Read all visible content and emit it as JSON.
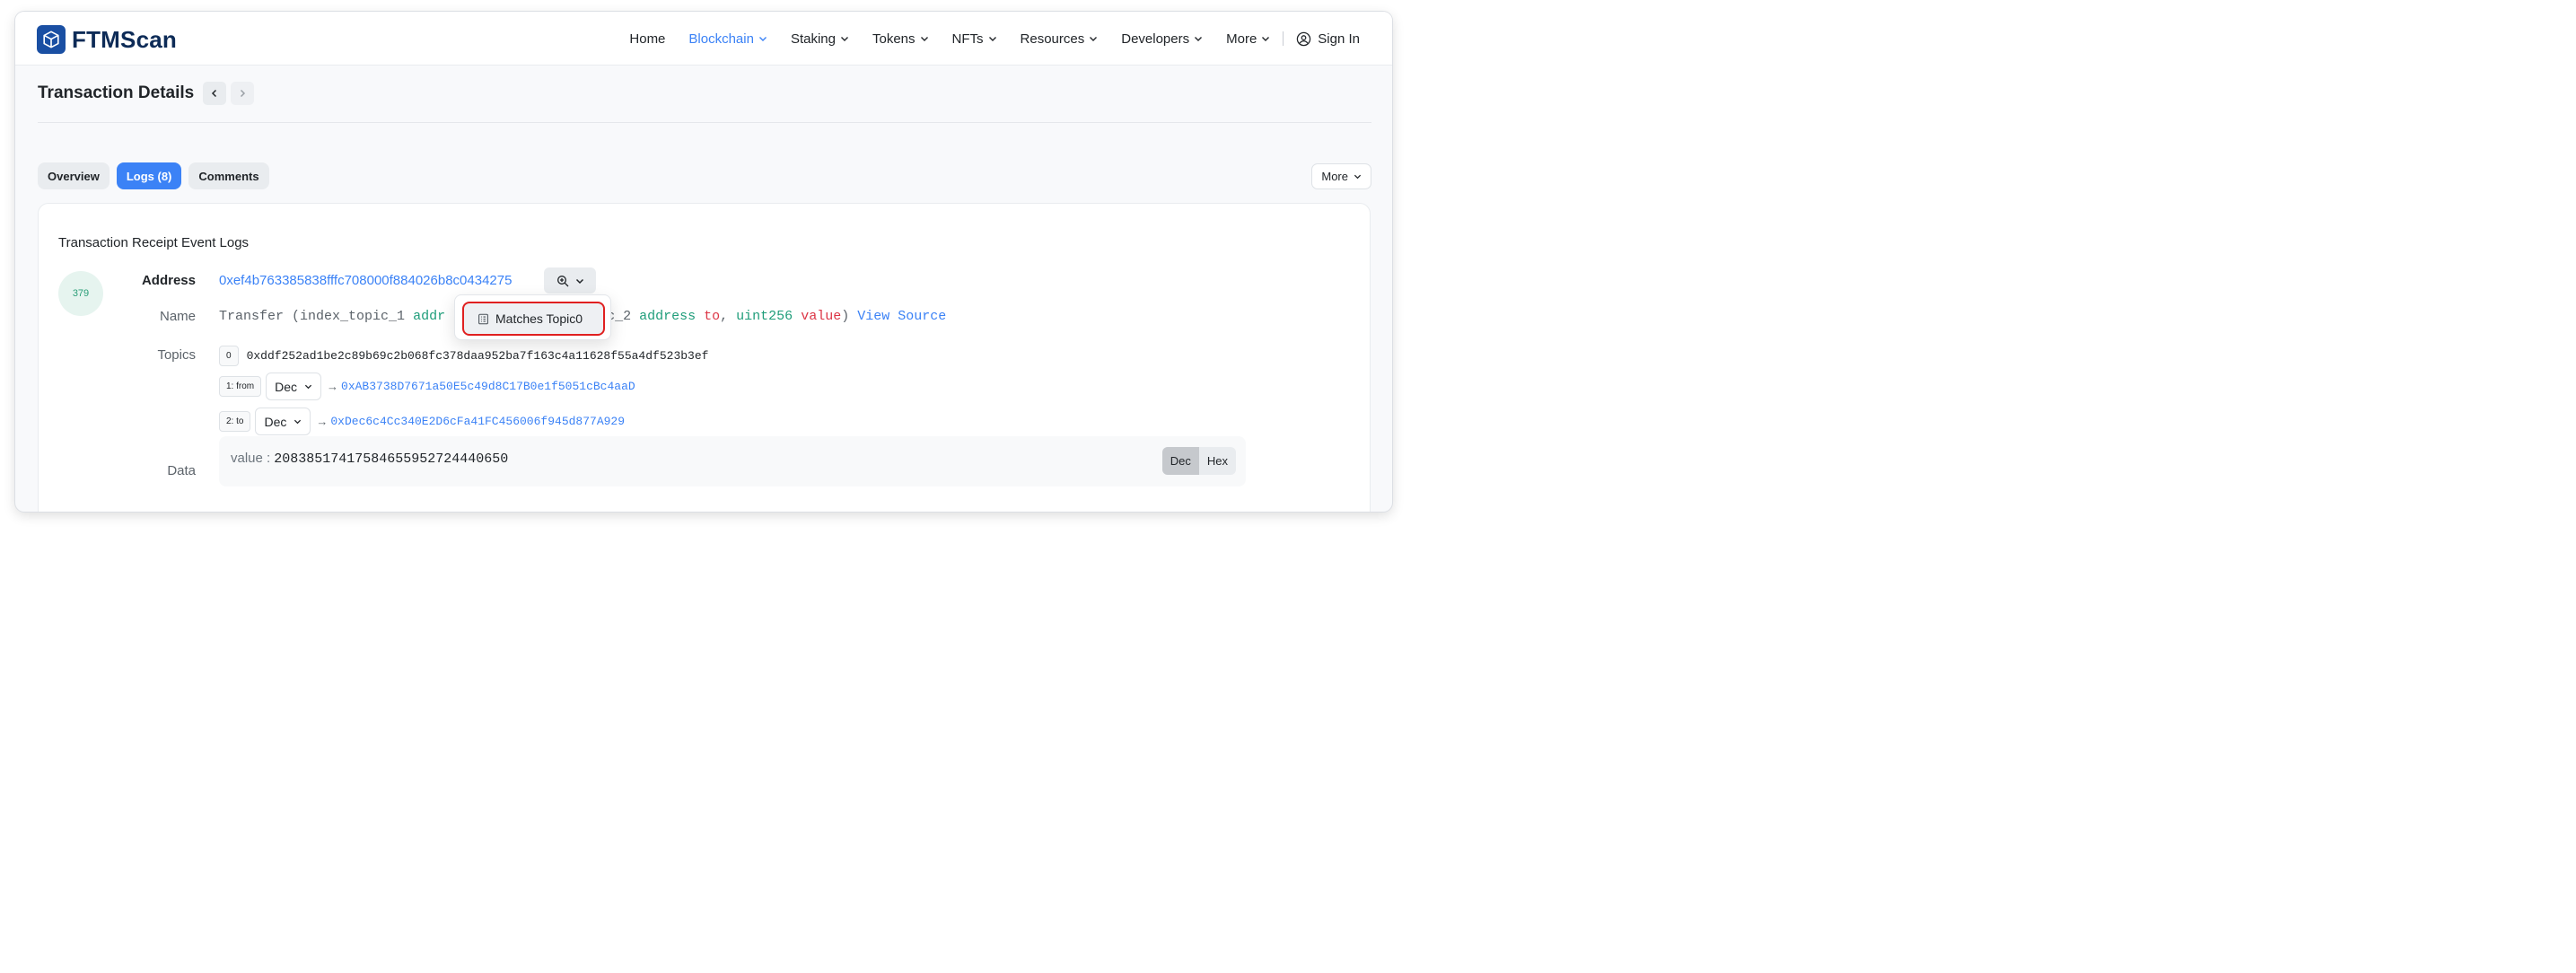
{
  "brand": {
    "name": "FTMScan"
  },
  "nav": {
    "items": [
      {
        "label": "Home",
        "dropdown": false
      },
      {
        "label": "Blockchain",
        "dropdown": true,
        "active": true
      },
      {
        "label": "Staking",
        "dropdown": true
      },
      {
        "label": "Tokens",
        "dropdown": true
      },
      {
        "label": "NFTs",
        "dropdown": true
      },
      {
        "label": "Resources",
        "dropdown": true
      },
      {
        "label": "Developers",
        "dropdown": true
      },
      {
        "label": "More",
        "dropdown": true
      }
    ],
    "signin": "Sign In"
  },
  "page": {
    "title": "Transaction Details"
  },
  "tabs": {
    "items": [
      {
        "label": "Overview",
        "active": false
      },
      {
        "label": "Logs (8)",
        "active": true
      },
      {
        "label": "Comments",
        "active": false
      }
    ],
    "more_label": "More"
  },
  "log": {
    "card_title": "Transaction Receipt Event Logs",
    "index": "379",
    "labels": {
      "address": "Address",
      "name": "Name",
      "topics": "Topics",
      "data": "Data"
    },
    "address": "0xef4b763385838fffc708000f884026b8c0434275",
    "name": {
      "fn": "Transfer",
      "p1_open": "(index_topic_1 ",
      "p1_type": "addr",
      "p2_tail": "c_2 ",
      "p2_type": "address",
      "p2_name": "to",
      "comma": ", ",
      "p3_type": "uint256",
      "p3_name": "value",
      "close": ")",
      "view_source": "View Source"
    },
    "topics": [
      {
        "badge": "0",
        "hash": "0xddf252ad1be2c89b69c2b068fc378daa952ba7f163c4a11628f55a4df523b3ef"
      },
      {
        "badge": "1: from",
        "format": "Dec",
        "arrow": "→",
        "value": "0xAB3738D7671a50E5c49d8C17B0e1f5051cBc4aaD"
      },
      {
        "badge": "2: to",
        "format": "Dec",
        "arrow": "→",
        "value": "0xDec6c4Cc340E2D6cFa41FC456006f945d877A929"
      }
    ],
    "data": {
      "key": "value :",
      "value": "20838517417584655952724440650",
      "formats": [
        "Dec",
        "Hex"
      ],
      "active_format": "Dec"
    }
  },
  "popup": {
    "item": "Matches Topic0"
  },
  "colors": {
    "accent": "#3b82f6",
    "brand": "#1a4fa3",
    "highlight": "#e02020"
  }
}
